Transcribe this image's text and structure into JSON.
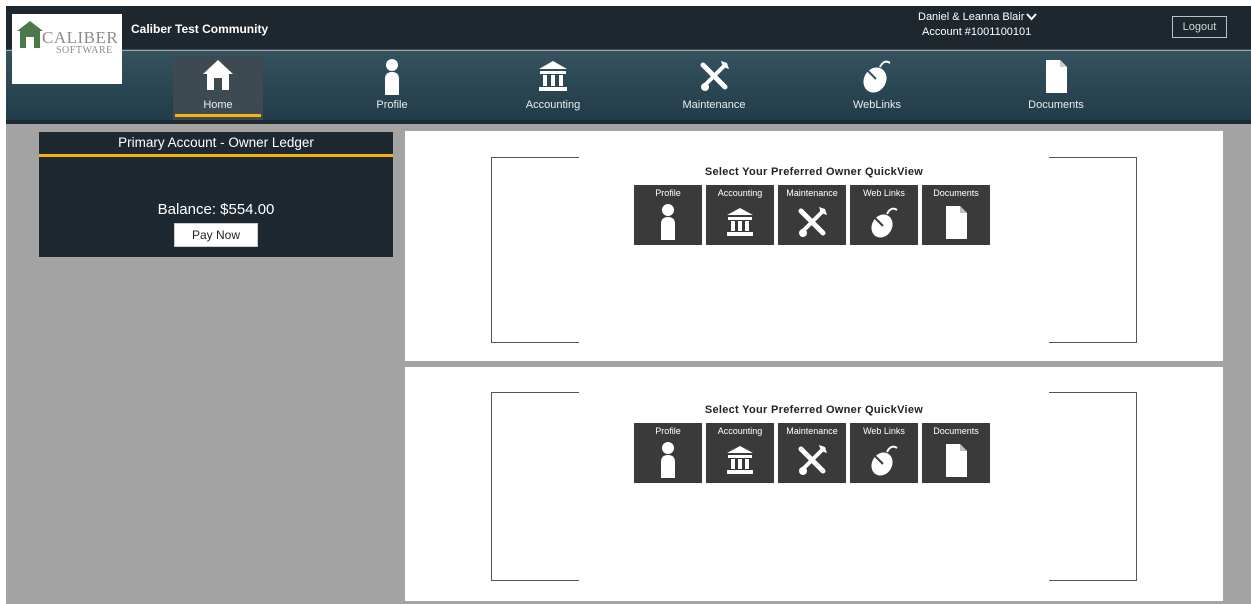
{
  "header": {
    "logo_line1": "CALIBER",
    "logo_line2": "SOFTWARE",
    "community_name": "Caliber Test Community",
    "user_name": "Daniel & Leanna Blair",
    "account_number": "Account #1001100101",
    "logout_label": "Logout"
  },
  "nav": {
    "items": [
      {
        "label": "Home",
        "icon": "home-icon",
        "active": true
      },
      {
        "label": "Profile",
        "icon": "person-icon"
      },
      {
        "label": "Accounting",
        "icon": "bank-icon"
      },
      {
        "label": "Maintenance",
        "icon": "tools-icon"
      },
      {
        "label": "WebLinks",
        "icon": "mouse-icon"
      },
      {
        "label": "Documents",
        "icon": "document-icon"
      }
    ]
  },
  "ledger": {
    "title": "Primary Account - Owner Ledger",
    "balance": "Balance: $554.00",
    "pay_label": "Pay Now"
  },
  "quickview": {
    "title": "Select Your Preferred Owner QuickView",
    "tiles": [
      {
        "label": "Profile",
        "icon": "person-icon"
      },
      {
        "label": "Accounting",
        "icon": "bank-icon"
      },
      {
        "label": "Maintenance",
        "icon": "tools-icon"
      },
      {
        "label": "Web Links",
        "icon": "mouse-icon"
      },
      {
        "label": "Documents",
        "icon": "document-icon"
      }
    ]
  },
  "colors": {
    "header_bg": "#1e272e",
    "nav_bg": "#2d4653",
    "accent": "#f5b311",
    "page_bg": "#a3a3a3",
    "tile_bg": "#3a3a3a"
  }
}
